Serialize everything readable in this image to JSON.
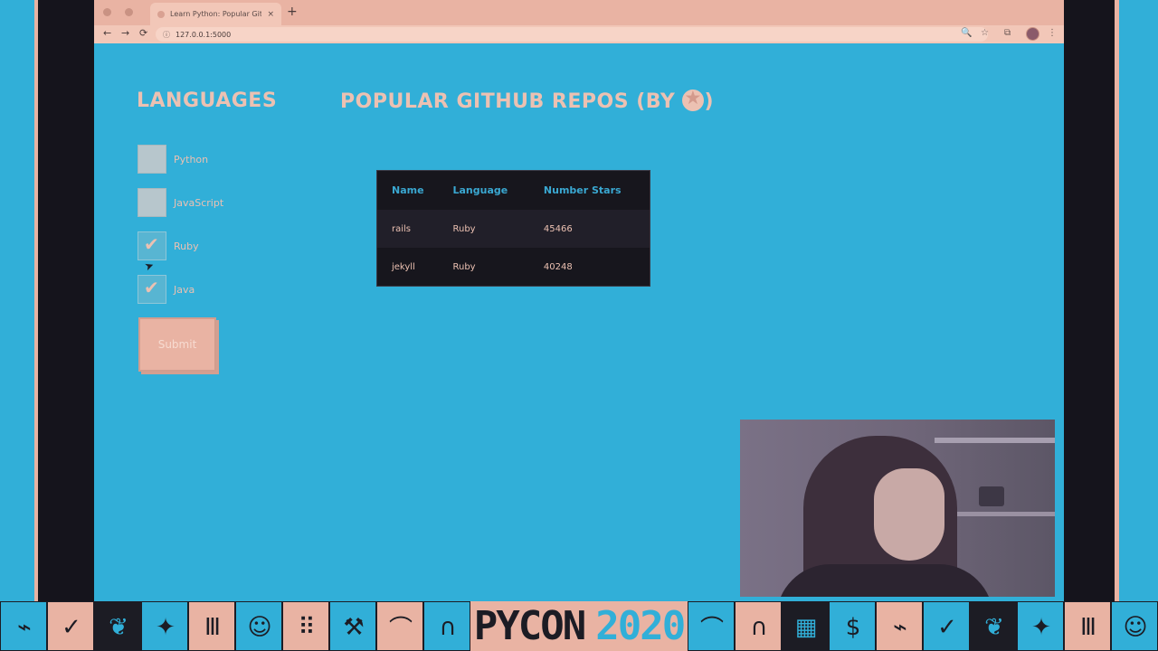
{
  "browser": {
    "tab_title": "Learn Python: Popular GitHub",
    "tab_close": "×",
    "new_tab": "+",
    "back": "←",
    "forward": "→",
    "reload": "⟳",
    "info_icon": "ⓘ",
    "url": "127.0.0.1:5000",
    "zoom_icon": "🔍",
    "bookmark_icon": "☆",
    "extension_icon": "⧉",
    "menu_icon": "⋮"
  },
  "page": {
    "languages_heading": "LANGUAGES",
    "repos_heading": "POPULAR GITHUB REPOS (BY",
    "repos_heading_close": ")",
    "languages": [
      {
        "label": "Python",
        "checked": false
      },
      {
        "label": "JavaScript",
        "checked": false
      },
      {
        "label": "Ruby",
        "checked": true
      },
      {
        "label": "Java",
        "checked": true
      }
    ],
    "submit_label": "Submit",
    "table": {
      "columns": [
        "Name",
        "Language",
        "Number Stars"
      ],
      "rows": [
        [
          "rails",
          "Ruby",
          "45466"
        ],
        [
          "jekyll",
          "Ruby",
          "40248"
        ]
      ]
    }
  },
  "banner": {
    "logo_text": "PYCON",
    "logo_year": "2020",
    "accent_color": "#31afd8",
    "brand_pink": "#e9b3a3",
    "dark_color": "#1c1c24"
  }
}
